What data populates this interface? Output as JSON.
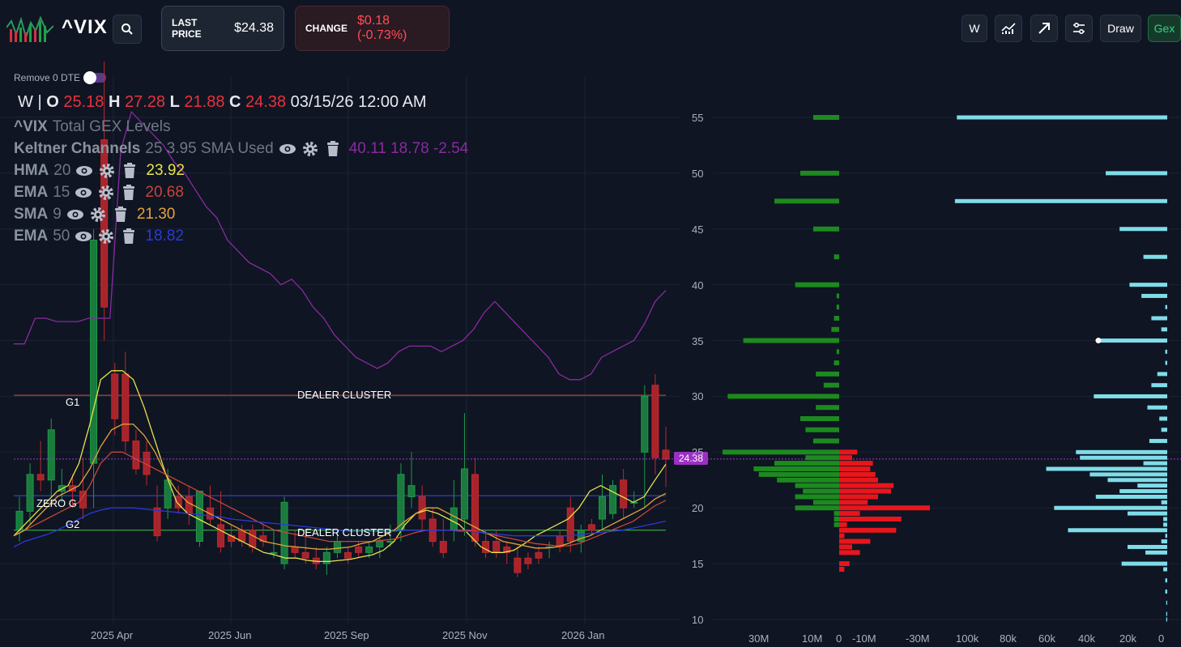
{
  "header": {
    "ticker": "^VIX",
    "last_price_label": "LAST PRICE",
    "last_price": "$24.38",
    "change_label": "CHANGE",
    "change": "$0.18 (-0.73%)"
  },
  "toolbar": {
    "interval": "W",
    "draw": "Draw",
    "gex": "Gex"
  },
  "options": {
    "remove_0dte": "Remove 0 DTE"
  },
  "ohlc": {
    "interval": "W",
    "sep": "|",
    "o_label": "O",
    "o": "25.18",
    "h_label": "H",
    "h": "27.28",
    "l_label": "L",
    "l": "21.88",
    "c_label": "C",
    "c": "24.38",
    "timestamp": "03/15/26 12:00 AM"
  },
  "indicators": [
    {
      "name": "^VIX",
      "param": "Total GEX Levels",
      "value": "",
      "color": ""
    },
    {
      "name": "Keltner Channels",
      "param": "25 3.95 SMA Used",
      "value": "40.11 18.78 -2.54",
      "color": "#9a2aa8"
    },
    {
      "name": "HMA",
      "param": "20",
      "value": "23.92",
      "color": "#e6e44a"
    },
    {
      "name": "EMA",
      "param": "15",
      "value": "20.68",
      "color": "#c9453a"
    },
    {
      "name": "SMA",
      "param": "9",
      "value": "21.30",
      "color": "#e8a23a"
    },
    {
      "name": "EMA",
      "param": "50",
      "value": "18.82",
      "color": "#2a3ad8"
    }
  ],
  "levels": {
    "dealer_cluster_upper": "DEALER CLUSTER",
    "dealer_cluster_lower": "DEALER CLUSTER",
    "g1": "G1",
    "zero_g": "ZERO G",
    "g2": "G2",
    "price_tag": "24.38"
  },
  "axes": {
    "x_ticks": [
      "2025 Apr",
      "2025 Jun",
      "2025 Sep",
      "2025 Nov",
      "2026 Jan"
    ],
    "y_ticks": [
      "55",
      "50",
      "45",
      "40",
      "35",
      "30",
      "25",
      "20",
      "15",
      "10"
    ],
    "gex_ticks": [
      "30M",
      "10M",
      "0",
      "-10M",
      "-30M"
    ],
    "oi_ticks": [
      "100k",
      "80k",
      "60k",
      "40k",
      "20k",
      "0"
    ]
  },
  "chart_data": [
    {
      "type": "candlestick",
      "title": "^VIX Total GEX Levels",
      "interval": "W",
      "y_range": [
        9,
        58
      ],
      "x_ticks": [
        "2025 Apr",
        "2025 Jun",
        "2025 Sep",
        "2025 Nov",
        "2026 Jan"
      ],
      "levels": {
        "dealer_cluster_upper": 30.1,
        "zero_g": 21.1,
        "dealer_cluster_lower": 18.0
      },
      "candles": [
        {
          "o": 18.0,
          "h": 21.0,
          "l": 17.0,
          "c": 19.7
        },
        {
          "o": 19.7,
          "h": 24.0,
          "l": 18.5,
          "c": 23.0
        },
        {
          "o": 23.0,
          "h": 26.0,
          "l": 21.5,
          "c": 22.5
        },
        {
          "o": 22.5,
          "h": 28.0,
          "l": 21.0,
          "c": 27.0
        },
        {
          "o": 21.5,
          "h": 23.5,
          "l": 20.5,
          "c": 22.0
        },
        {
          "o": 22.0,
          "h": 23.0,
          "l": 20.0,
          "c": 21.5
        },
        {
          "o": 21.5,
          "h": 24.5,
          "l": 19.0,
          "c": 20.0
        },
        {
          "o": 24.0,
          "h": 45.0,
          "l": 20.0,
          "c": 44.0
        },
        {
          "o": 53.0,
          "h": 60.0,
          "l": 35.0,
          "c": 38.0
        },
        {
          "o": 32.0,
          "h": 33.0,
          "l": 26.5,
          "c": 28.0
        },
        {
          "o": 32.0,
          "h": 34.0,
          "l": 25.0,
          "c": 26.0
        },
        {
          "o": 26.0,
          "h": 27.0,
          "l": 23.0,
          "c": 23.5
        },
        {
          "o": 25.0,
          "h": 26.0,
          "l": 22.0,
          "c": 23.0
        },
        {
          "o": 20.0,
          "h": 22.0,
          "l": 17.0,
          "c": 17.5
        },
        {
          "o": 20.0,
          "h": 23.5,
          "l": 19.0,
          "c": 22.5
        },
        {
          "o": 21.0,
          "h": 22.0,
          "l": 19.5,
          "c": 20.0
        },
        {
          "o": 21.0,
          "h": 22.0,
          "l": 18.5,
          "c": 19.5
        },
        {
          "o": 17.0,
          "h": 21.5,
          "l": 16.5,
          "c": 21.5
        },
        {
          "o": 20.0,
          "h": 22.0,
          "l": 18.5,
          "c": 19.0
        },
        {
          "o": 18.5,
          "h": 21.5,
          "l": 16.0,
          "c": 16.5
        },
        {
          "o": 17.5,
          "h": 18.5,
          "l": 16.5,
          "c": 17.0
        },
        {
          "o": 18.0,
          "h": 18.5,
          "l": 16.5,
          "c": 17.0
        },
        {
          "o": 18.0,
          "h": 18.5,
          "l": 16.0,
          "c": 16.5
        },
        {
          "o": 17.5,
          "h": 18.5,
          "l": 16.5,
          "c": 17.0
        },
        {
          "o": 16.0,
          "h": 18.0,
          "l": 15.5,
          "c": 16.0
        },
        {
          "o": 15.0,
          "h": 21.0,
          "l": 14.5,
          "c": 20.5
        },
        {
          "o": 16.5,
          "h": 18.0,
          "l": 15.5,
          "c": 16.0
        },
        {
          "o": 16.0,
          "h": 18.0,
          "l": 15.0,
          "c": 15.5
        },
        {
          "o": 15.5,
          "h": 16.5,
          "l": 14.5,
          "c": 15.0
        },
        {
          "o": 15.0,
          "h": 16.5,
          "l": 14.0,
          "c": 16.0
        },
        {
          "o": 16.0,
          "h": 18.0,
          "l": 15.5,
          "c": 17.0
        },
        {
          "o": 16.0,
          "h": 16.5,
          "l": 15.0,
          "c": 15.5
        },
        {
          "o": 16.5,
          "h": 17.0,
          "l": 15.5,
          "c": 16.0
        },
        {
          "o": 16.0,
          "h": 17.0,
          "l": 15.5,
          "c": 16.5
        },
        {
          "o": 16.5,
          "h": 17.5,
          "l": 15.5,
          "c": 17.0
        },
        {
          "o": 17.0,
          "h": 18.5,
          "l": 16.5,
          "c": 17.0
        },
        {
          "o": 18.0,
          "h": 24.0,
          "l": 17.0,
          "c": 23.0
        },
        {
          "o": 21.0,
          "h": 25.0,
          "l": 20.0,
          "c": 22.0
        },
        {
          "o": 21.0,
          "h": 22.0,
          "l": 18.0,
          "c": 19.0
        },
        {
          "o": 19.0,
          "h": 20.0,
          "l": 16.5,
          "c": 17.0
        },
        {
          "o": 17.0,
          "h": 19.0,
          "l": 15.5,
          "c": 16.0
        },
        {
          "o": 18.0,
          "h": 22.5,
          "l": 17.0,
          "c": 20.0
        },
        {
          "o": 19.0,
          "h": 28.5,
          "l": 17.5,
          "c": 23.5
        },
        {
          "o": 23.0,
          "h": 24.5,
          "l": 16.5,
          "c": 17.0
        },
        {
          "o": 17.0,
          "h": 18.0,
          "l": 15.5,
          "c": 16.0
        },
        {
          "o": 17.0,
          "h": 18.0,
          "l": 15.5,
          "c": 16.0
        },
        {
          "o": 16.5,
          "h": 17.0,
          "l": 15.0,
          "c": 16.0
        },
        {
          "o": 15.5,
          "h": 16.5,
          "l": 13.8,
          "c": 14.2
        },
        {
          "o": 15.5,
          "h": 16.0,
          "l": 14.5,
          "c": 15.0
        },
        {
          "o": 16.0,
          "h": 16.5,
          "l": 15.0,
          "c": 15.5
        },
        {
          "o": 16.5,
          "h": 17.0,
          "l": 15.5,
          "c": 16.5
        },
        {
          "o": 17.5,
          "h": 18.0,
          "l": 16.0,
          "c": 16.5
        },
        {
          "o": 20.0,
          "h": 21.0,
          "l": 16.0,
          "c": 17.0
        },
        {
          "o": 17.0,
          "h": 18.5,
          "l": 16.0,
          "c": 18.0
        },
        {
          "o": 18.5,
          "h": 19.0,
          "l": 17.5,
          "c": 18.0
        },
        {
          "o": 19.0,
          "h": 23.0,
          "l": 18.0,
          "c": 21.0
        },
        {
          "o": 19.5,
          "h": 22.5,
          "l": 19.0,
          "c": 22.0
        },
        {
          "o": 22.5,
          "h": 23.5,
          "l": 19.0,
          "c": 20.0
        },
        {
          "o": 20.5,
          "h": 21.5,
          "l": 20.0,
          "c": 20.5
        },
        {
          "o": 25.0,
          "h": 31.0,
          "l": 20.0,
          "c": 30.0
        },
        {
          "o": 31.0,
          "h": 32.0,
          "l": 23.0,
          "c": 24.5
        },
        {
          "o": 25.18,
          "h": 27.28,
          "l": 21.88,
          "c": 24.38
        }
      ],
      "series": [
        {
          "name": "Keltner Channels",
          "values": [
            34.7,
            34.7,
            37.0,
            37.0,
            36.7,
            36.7,
            36.7,
            37.0,
            37.0,
            37.0,
            52.0,
            55.5,
            54.5,
            53.5,
            52.5,
            51.0,
            50.0,
            48.5,
            47.0,
            46.0,
            44.0,
            43.0,
            42.0,
            41.5,
            41.0,
            40.0,
            40.5,
            39.5,
            38.0,
            37.0,
            35.5,
            34.5,
            33.5,
            33.0,
            32.5,
            33.0,
            34.0,
            34.5,
            34.5,
            34.5,
            34.0,
            34.5,
            35.0,
            36.0,
            37.5,
            38.5,
            37.5,
            36.5,
            35.5,
            34.5,
            33.5,
            32.0,
            31.5,
            31.5,
            32.0,
            33.5,
            34.0,
            34.5,
            35.0,
            36.5,
            38.5,
            39.5
          ]
        },
        {
          "name": "HMA",
          "values": [
            17.5,
            18.5,
            19.5,
            20.5,
            21.5,
            22.0,
            24.0,
            27.5,
            31.5,
            32.3,
            32.3,
            31.5,
            29.0,
            26.0,
            23.0,
            20.5,
            19.5,
            19.0,
            18.5,
            18.0,
            17.5,
            17.0,
            16.5,
            16.0,
            15.8,
            15.5,
            15.5,
            15.3,
            15.2,
            15.2,
            15.3,
            15.4,
            15.6,
            15.8,
            16.2,
            17.0,
            18.5,
            19.5,
            19.8,
            19.5,
            19.0,
            18.5,
            17.5,
            16.5,
            16.0,
            16.0,
            16.2,
            16.8,
            17.5,
            18.0,
            18.5,
            19.0,
            20.0,
            21.5,
            22.0,
            21.5,
            21.0,
            20.5,
            21.0,
            22.5,
            23.92
          ]
        },
        {
          "name": "EMA 15",
          "values": [
            17.5,
            18.0,
            18.5,
            19.0,
            19.5,
            20.0,
            20.5,
            22.0,
            24.0,
            25.0,
            25.0,
            24.5,
            24.0,
            23.5,
            23.0,
            22.5,
            22.0,
            21.5,
            21.0,
            20.5,
            20.0,
            19.5,
            19.0,
            18.5,
            18.0,
            17.8,
            17.6,
            17.4,
            17.2,
            17.0,
            17.0,
            17.0,
            17.0,
            17.0,
            17.1,
            17.2,
            17.5,
            17.8,
            18.0,
            18.0,
            18.0,
            18.0,
            18.0,
            17.8,
            17.6,
            17.4,
            17.2,
            17.0,
            16.8,
            16.7,
            16.6,
            16.6,
            16.8,
            17.2,
            17.6,
            18.0,
            18.4,
            18.8,
            19.5,
            20.2,
            20.68
          ]
        },
        {
          "name": "SMA 9",
          "values": [
            17.5,
            18.0,
            19.0,
            20.0,
            21.0,
            21.5,
            22.0,
            23.5,
            25.5,
            27.0,
            27.5,
            27.5,
            26.5,
            25.0,
            23.0,
            21.5,
            20.5,
            20.0,
            19.5,
            19.0,
            18.5,
            18.0,
            17.5,
            17.0,
            16.8,
            16.6,
            16.5,
            16.4,
            16.3,
            16.3,
            16.4,
            16.5,
            16.8,
            17.0,
            17.5,
            18.0,
            18.8,
            19.5,
            20.0,
            20.0,
            19.5,
            19.0,
            18.5,
            18.0,
            17.5,
            17.0,
            16.8,
            16.6,
            16.4,
            16.4,
            16.5,
            16.8,
            17.2,
            17.5,
            18.0,
            18.5,
            19.0,
            19.5,
            20.0,
            20.8,
            21.3
          ]
        },
        {
          "name": "EMA 50",
          "values": [
            16.5,
            17.0,
            17.3,
            17.6,
            18.0,
            18.5,
            19.0,
            19.5,
            19.8,
            20.0,
            20.0,
            20.0,
            19.9,
            19.8,
            19.7,
            19.6,
            19.5,
            19.4,
            19.3,
            19.2,
            19.0,
            18.9,
            18.8,
            18.7,
            18.6,
            18.5,
            18.4,
            18.3,
            18.2,
            18.1,
            18.0,
            17.9,
            17.9,
            17.9,
            17.9,
            17.9,
            18.0,
            18.0,
            18.0,
            18.0,
            18.0,
            17.9,
            17.9,
            17.8,
            17.7,
            17.6,
            17.5,
            17.5,
            17.5,
            17.5,
            17.5,
            17.5,
            17.6,
            17.7,
            17.8,
            17.9,
            18.0,
            18.2,
            18.4,
            18.6,
            18.82
          ]
        }
      ]
    },
    {
      "type": "bar",
      "title": "Total GEX",
      "orientation": "horizontal",
      "x_ticks": [
        "30M",
        "10M",
        "0",
        "-10M",
        "-30M"
      ],
      "levels": [
        55,
        50,
        47.5,
        45,
        42.5,
        40,
        39,
        38,
        37,
        36,
        35,
        34,
        33,
        32,
        31,
        30,
        29,
        28,
        27,
        26,
        25,
        24.5,
        24,
        23.5,
        23,
        22.5,
        22,
        21.5,
        21,
        20.5,
        20,
        19.5,
        19,
        18.5,
        18,
        17.5,
        17,
        16.5,
        16,
        15,
        14.5
      ],
      "positive_gamma": [
        10,
        15,
        25,
        10,
        2,
        17,
        1,
        1,
        2,
        3,
        37,
        1,
        2,
        9,
        6,
        43,
        9,
        15,
        13,
        10,
        45,
        13,
        25,
        33,
        31,
        24,
        17,
        14,
        17,
        10,
        17,
        2,
        2,
        2,
        0,
        0,
        0,
        0,
        0,
        0,
        0
      ],
      "negative_gamma": [
        0,
        0,
        0,
        0,
        0,
        0,
        0,
        0,
        0,
        0,
        0,
        0,
        0,
        0,
        0,
        0,
        0,
        0,
        0,
        0,
        7,
        5,
        13,
        12,
        14,
        15,
        21,
        20,
        15,
        11,
        35,
        8,
        24,
        3,
        22,
        2,
        12,
        5,
        8,
        4,
        2
      ]
    },
    {
      "type": "bar",
      "title": "Open Interest",
      "orientation": "horizontal",
      "x_ticks": [
        "100k",
        "80k",
        "60k",
        "40k",
        "20k",
        "0"
      ],
      "levels": [
        55,
        50,
        47.5,
        45,
        42.5,
        40,
        39,
        38,
        37,
        36,
        35,
        34,
        33,
        32,
        31,
        30,
        29,
        28,
        27,
        26,
        25,
        24.5,
        24,
        23.5,
        23,
        22.5,
        22,
        21.5,
        21,
        20.5,
        20,
        19.5,
        19,
        18.5,
        18,
        17.5,
        17,
        16.5,
        16,
        15,
        14.5,
        13.5,
        12.5,
        11.5,
        10.5,
        10
      ],
      "values": [
        106,
        31,
        107,
        24,
        12,
        19,
        13,
        1,
        8,
        3,
        35,
        1,
        1,
        5,
        8,
        37,
        10,
        4,
        3,
        9,
        46,
        44,
        12,
        61,
        39,
        30,
        15,
        24,
        36,
        3,
        57,
        20,
        2,
        2,
        50,
        1,
        3,
        20,
        11,
        23,
        2,
        1,
        1,
        0.5,
        0.5,
        0.5
      ]
    }
  ]
}
